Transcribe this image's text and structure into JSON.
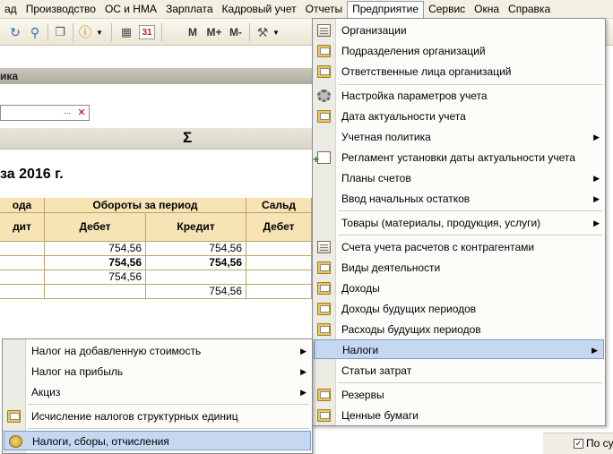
{
  "menubar": {
    "items": [
      "ад",
      "Производство",
      "ОС и НМА",
      "Зарплата",
      "Кадровый учет",
      "Отчеты",
      "Предприятие",
      "Сервис",
      "Окна",
      "Справка"
    ],
    "active_index": 6
  },
  "toolbar": {
    "m": "M",
    "mplus": "M+",
    "mminus": "M-",
    "calendar_day": "31"
  },
  "form": {
    "title": "ика",
    "org_dots": "...",
    "org_clear": "✕",
    "sigma": "Σ",
    "report_title": "за 2016 г."
  },
  "grid": {
    "header1": [
      "ода",
      "Обороты за период",
      "Сальд"
    ],
    "header2": [
      "дит",
      "Дебет",
      "Кредит",
      "Дебет"
    ],
    "rows": [
      {
        "debet": "754,56",
        "kredit": "754,56"
      },
      {
        "debet": "754,56",
        "kredit": "754,56"
      },
      {
        "debet": "754,56",
        "kredit": ""
      },
      {
        "debet": "",
        "kredit": "754,56"
      }
    ]
  },
  "enterprise_menu": {
    "items": [
      {
        "label": "Организации",
        "icon": "document-icon"
      },
      {
        "label": "Подразделения организаций",
        "icon": "folder-icon"
      },
      {
        "label": "Ответственные лица организаций",
        "icon": "folder-icon"
      },
      {
        "label": "Настройка параметров учета",
        "icon": "gear-icon"
      },
      {
        "label": "Дата актуальности учета",
        "icon": "folder-icon"
      },
      {
        "label": "Учетная политика",
        "submenu": true
      },
      {
        "label": "Регламент установки даты актуальности учета",
        "icon": "add-icon"
      },
      {
        "label": "Планы счетов",
        "submenu": true
      },
      {
        "label": "Ввод начальных остатков",
        "submenu": true
      },
      {
        "label": "Товары (материалы, продукция, услуги)",
        "submenu": true
      },
      {
        "label": "Счета учета расчетов с контрагентами",
        "icon": "document-icon"
      },
      {
        "label": "Виды деятельности",
        "icon": "folder-icon"
      },
      {
        "label": "Доходы",
        "icon": "folder-icon"
      },
      {
        "label": "Доходы будущих периодов",
        "icon": "folder-icon"
      },
      {
        "label": "Расходы будущих периодов",
        "icon": "folder-icon"
      },
      {
        "label": "Налоги",
        "submenu": true,
        "highlighted": true
      },
      {
        "label": "Статьи затрат",
        "icon": "folder-icon"
      },
      {
        "label": "Резервы",
        "icon": "folder-icon"
      },
      {
        "label": "Ценные бумаги",
        "icon": "folder-icon"
      }
    ]
  },
  "taxes_menu": {
    "items": [
      {
        "label": "Налог на добавленную стоимость",
        "submenu": true
      },
      {
        "label": "Налог на прибыль",
        "submenu": true
      },
      {
        "label": "Акциз",
        "submenu": true
      },
      {
        "label": "Исчисление налогов структурных единиц",
        "icon": "folder-icon"
      },
      {
        "label": "Налоги, сборы, отчисления",
        "icon": "coins-icon",
        "highlighted": true
      }
    ]
  },
  "right_panel": {
    "checkbox_label": "По суб",
    "checked": true
  }
}
